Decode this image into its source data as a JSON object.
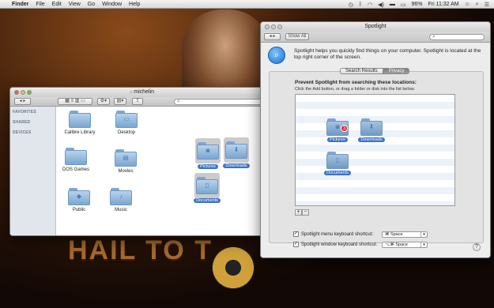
{
  "menubar": {
    "app": "Finder",
    "items": [
      "File",
      "Edit",
      "View",
      "Go",
      "Window",
      "Help"
    ],
    "battery": "96%",
    "clock": "Fri 11:32 AM"
  },
  "finder": {
    "title": "michelin",
    "sidebar_heads": [
      "FAVORITES",
      "SHARED",
      "DEVICES"
    ],
    "folders": [
      {
        "label": "Calibre Library",
        "icon": "folder-icon"
      },
      {
        "label": "Desktop",
        "icon": "desktop-folder-icon"
      },
      {
        "label": "DOS Games",
        "icon": "folder-icon"
      },
      {
        "label": "Movies",
        "icon": "movies-folder-icon"
      },
      {
        "label": "Public",
        "icon": "public-folder-icon"
      },
      {
        "label": "Music",
        "icon": "music-folder-icon"
      }
    ],
    "selected": [
      "Pictures",
      "Downloads",
      "Documents"
    ]
  },
  "spotlight": {
    "title": "Spotlight",
    "show_all": "Show All",
    "description": "Spotlight helps you quickly find things on your computer. Spotlight is located at the top right corner of the screen.",
    "tabs": [
      "Search Results",
      "Privacy"
    ],
    "active_tab": "Privacy",
    "privacy_heading": "Prevent Spotlight from searching these locations:",
    "privacy_hint": "Click the Add button, or drag a folder or disk into the list below.",
    "dragged": [
      {
        "label": "Pictures",
        "badge": "3"
      },
      {
        "label": "Downloads"
      },
      {
        "label": "Documents"
      }
    ],
    "add": "+",
    "remove": "−",
    "shortcut_menu_label": "Spotlight menu keyboard shortcut:",
    "shortcut_menu_value": "⌘ Space",
    "shortcut_window_label": "Spotlight window keyboard shortcut:",
    "shortcut_window_value": "⌥⌘ Space",
    "help": "?"
  },
  "colors": {
    "accent": "#3d74c7",
    "folder": "#7aa6d1"
  }
}
